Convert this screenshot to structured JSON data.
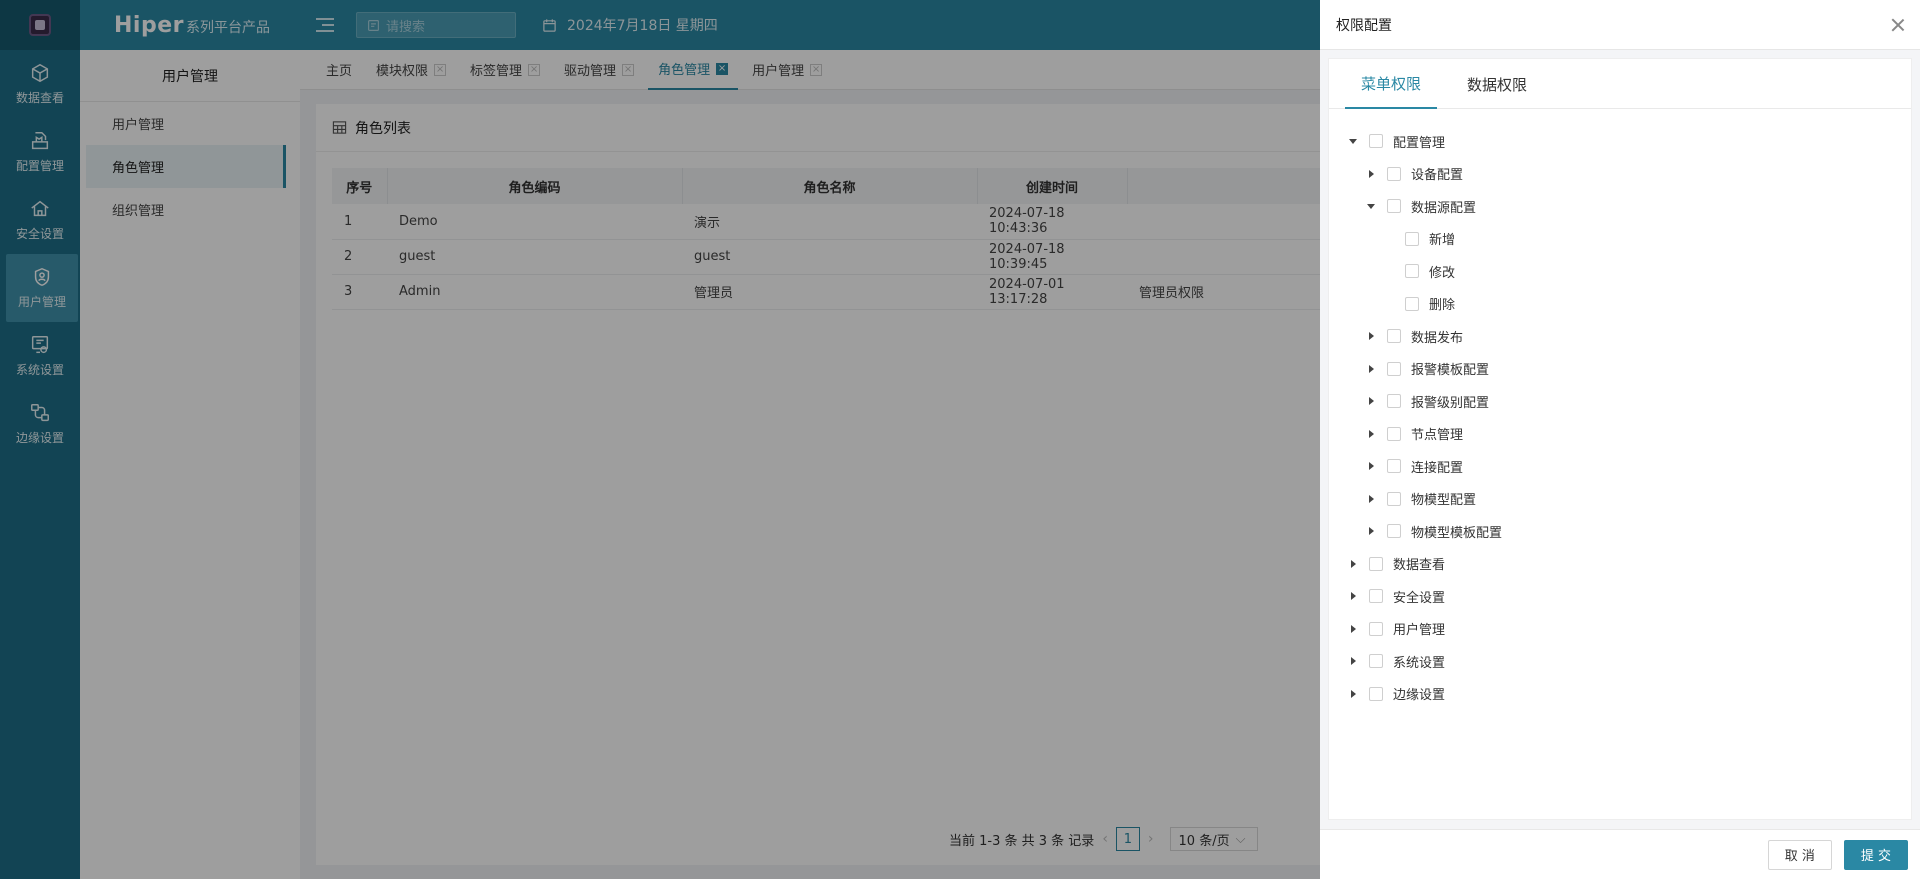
{
  "rail": {
    "items": [
      {
        "label": "数据查看",
        "icon": "cube-icon"
      },
      {
        "label": "配置管理",
        "icon": "config-icon"
      },
      {
        "label": "安全设置",
        "icon": "home-shield-icon"
      },
      {
        "label": "用户管理",
        "icon": "user-shield-icon"
      },
      {
        "label": "系统设置",
        "icon": "system-settings-icon"
      },
      {
        "label": "边缘设置",
        "icon": "edge-icon"
      }
    ]
  },
  "header": {
    "brand_main": "Hiper",
    "brand_sub": "系列平台产品",
    "search_placeholder": "请搜索",
    "date": "2024年7月18日 星期四"
  },
  "subnav": {
    "title": "用户管理",
    "items": [
      "用户管理",
      "角色管理",
      "组织管理"
    ]
  },
  "tabs": [
    "主页",
    "模块权限",
    "标签管理",
    "驱动管理",
    "角色管理",
    "用户管理"
  ],
  "card": {
    "title": "角色列表",
    "columns": [
      "序号",
      "角色编码",
      "角色名称",
      "创建时间",
      ""
    ],
    "rows": [
      [
        "1",
        "Demo",
        "演示",
        "2024-07-18 10:43:36",
        ""
      ],
      [
        "2",
        "guest",
        "guest",
        "2024-07-18 10:39:45",
        ""
      ],
      [
        "3",
        "Admin",
        "管理员",
        "2024-07-01 13:17:28",
        "管理员权限"
      ]
    ],
    "pager": {
      "summary": "当前 1-3 条 共 3 条 记录",
      "current_page": "1",
      "page_size": "10 条/页"
    }
  },
  "drawer": {
    "title": "权限配置",
    "tabs": [
      "菜单权限",
      "数据权限"
    ],
    "tree": [
      {
        "label": "配置管理",
        "level": 0,
        "state": "down"
      },
      {
        "label": "设备配置",
        "level": 1,
        "state": "right"
      },
      {
        "label": "数据源配置",
        "level": 1,
        "state": "down"
      },
      {
        "label": "新增",
        "level": 2,
        "state": "none"
      },
      {
        "label": "修改",
        "level": 2,
        "state": "none"
      },
      {
        "label": "删除",
        "level": 2,
        "state": "none"
      },
      {
        "label": "数据发布",
        "level": 1,
        "state": "right"
      },
      {
        "label": "报警模板配置",
        "level": 1,
        "state": "right"
      },
      {
        "label": "报警级别配置",
        "level": 1,
        "state": "right"
      },
      {
        "label": "节点管理",
        "level": 1,
        "state": "right"
      },
      {
        "label": "连接配置",
        "level": 1,
        "state": "right"
      },
      {
        "label": "物模型配置",
        "level": 1,
        "state": "right"
      },
      {
        "label": "物模型模板配置",
        "level": 1,
        "state": "right"
      },
      {
        "label": "数据查看",
        "level": 0,
        "state": "right"
      },
      {
        "label": "安全设置",
        "level": 0,
        "state": "right"
      },
      {
        "label": "用户管理",
        "level": 0,
        "state": "right"
      },
      {
        "label": "系统设置",
        "level": 0,
        "state": "right"
      },
      {
        "label": "边缘设置",
        "level": 0,
        "state": "right"
      }
    ],
    "cancel_label": "取 消",
    "submit_label": "提 交"
  }
}
